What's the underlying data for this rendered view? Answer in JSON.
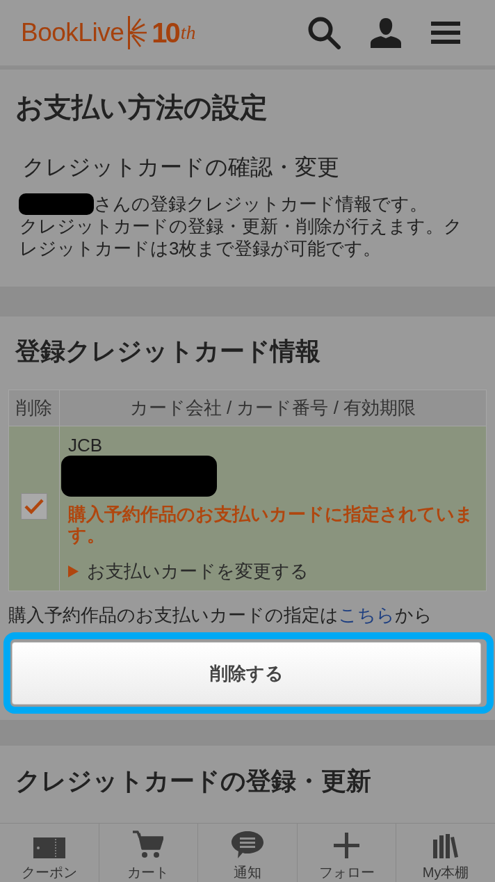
{
  "header": {
    "logo": {
      "wordmark": "BookLive",
      "badge_number": "10",
      "badge_suffix": "th"
    }
  },
  "payment_method": {
    "title": "お支払い方法の設定",
    "subtitle": "クレジットカードの確認・変更",
    "description_lines": [
      "さんの登録クレジットカード情報です。",
      "クレジットカードの登録・更新・削除が行えます。クレジットカードは3枚まで登録が可能です。"
    ]
  },
  "registered_cards": {
    "title": "登録クレジットカード情報",
    "table": {
      "columns": [
        "削除",
        "カード会社 / カード番号 / 有効期限"
      ],
      "rows": [
        {
          "checked": true,
          "issuer": "JCB",
          "notice": "購入予約作品のお支払いカードに指定されています。",
          "action": "お支払いカードを変更する"
        }
      ]
    },
    "note": {
      "before": "購入予約作品のお支払いカードの指定は",
      "link": "こちら",
      "after": "から"
    },
    "delete_button": {
      "label": "削除する",
      "highlighted": true
    }
  },
  "register_update": {
    "title": "クレジットカードの登録・更新"
  },
  "bottom_nav": [
    {
      "kind": "coupon",
      "label": "クーポン"
    },
    {
      "kind": "cart",
      "label": "カート"
    },
    {
      "kind": "notification",
      "label": "通知"
    },
    {
      "kind": "follow",
      "label": "フォロー"
    },
    {
      "kind": "bookshelf",
      "label": "My本棚"
    }
  ]
}
